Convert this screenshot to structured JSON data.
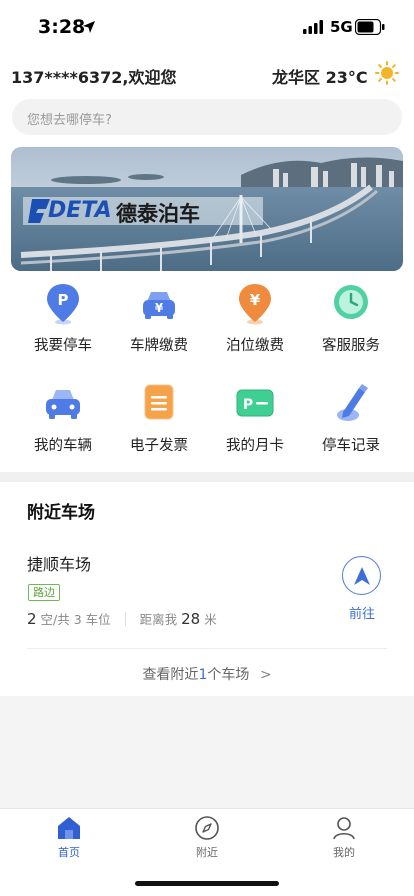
{
  "status_bar": {
    "time": "3:28",
    "network": "5G"
  },
  "header": {
    "greeting": "137****6372,欢迎您",
    "weather": "龙华区 23°C"
  },
  "search": {
    "placeholder": "您想去哪停车?"
  },
  "banner": {
    "logo_latin": "DETA",
    "logo_cn": "德泰泊车"
  },
  "features": [
    {
      "label": "我要停车",
      "icon": "parking-pin-icon"
    },
    {
      "label": "车牌缴费",
      "icon": "car-yuan-icon"
    },
    {
      "label": "泊位缴费",
      "icon": "yuan-pin-icon"
    },
    {
      "label": "客服服务",
      "icon": "clock-icon"
    },
    {
      "label": "我的车辆",
      "icon": "car-icon"
    },
    {
      "label": "电子发票",
      "icon": "invoice-icon"
    },
    {
      "label": "我的月卡",
      "icon": "monthly-card-icon"
    },
    {
      "label": "停车记录",
      "icon": "pencil-record-icon"
    }
  ],
  "nearby": {
    "heading": "附近车场",
    "lot": {
      "name": "捷顺车场",
      "tag": "路边",
      "free_spots": "2",
      "free_label": "空",
      "total_label": "/共 3 车位",
      "distance_label": "距离我",
      "distance": "28",
      "distance_unit": "米",
      "navigate_label": "前往"
    },
    "more_prefix": "查看附近",
    "more_count": "1",
    "more_suffix": "个车场",
    "more_arrow": ">"
  },
  "tabbar": {
    "tabs": [
      {
        "label": "首页",
        "active": true
      },
      {
        "label": "附近",
        "active": false
      },
      {
        "label": "我的",
        "active": false
      }
    ]
  },
  "colors": {
    "accent": "#3d6fd9",
    "tag_green": "#5aa63a",
    "sun": "#f4b42a"
  }
}
